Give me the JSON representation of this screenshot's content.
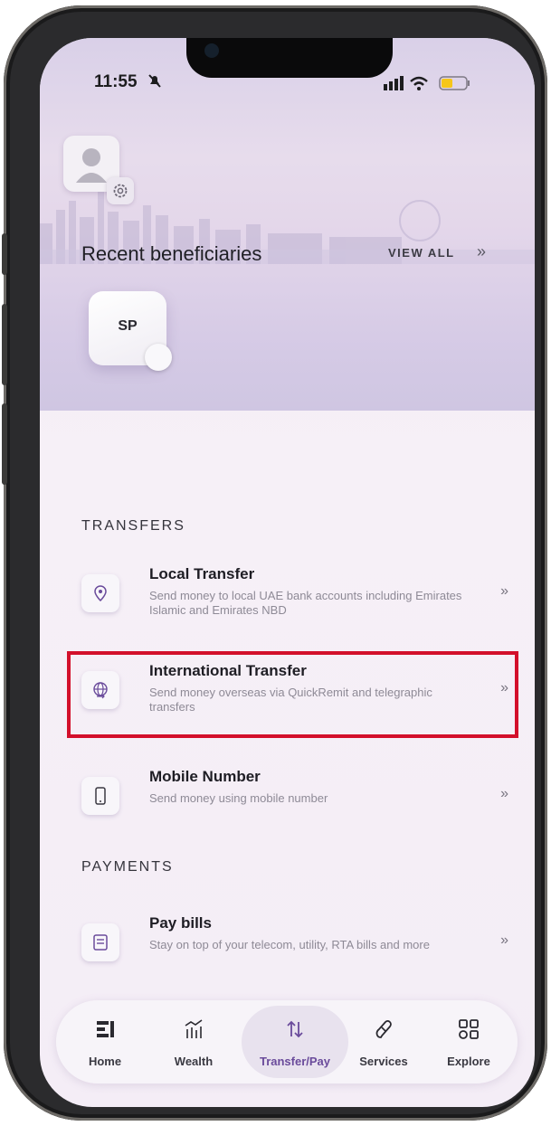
{
  "status_bar": {
    "time": "11:55"
  },
  "beneficiaries": {
    "title": "Recent beneficiaries",
    "view_all": "VIEW ALL",
    "items": [
      {
        "initials": "SP"
      }
    ]
  },
  "transfers": {
    "section_title": "TRANSFERS",
    "items": [
      {
        "title": "Local Transfer",
        "description": "Send money to local UAE bank accounts including Emirates Islamic and  Emirates NBD",
        "icon": "location-pin-icon"
      },
      {
        "title": "International Transfer",
        "description": "Send money overseas via QuickRemit and telegraphic transfers",
        "icon": "globe-transfer-icon"
      },
      {
        "title": "Mobile Number",
        "description": "Send money using mobile number",
        "icon": "mobile-phone-icon"
      }
    ]
  },
  "payments": {
    "section_title": "PAYMENTS",
    "items": [
      {
        "title": "Pay bills",
        "description": "Stay on top of your telecom, utility, RTA bills and more",
        "icon": "bill-icon"
      }
    ]
  },
  "nav": {
    "items": [
      {
        "label": "Home",
        "icon": "home-icon"
      },
      {
        "label": "Wealth",
        "icon": "wealth-icon"
      },
      {
        "label": "Transfer/Pay",
        "icon": "transfer-icon",
        "active": true
      },
      {
        "label": "Services",
        "icon": "services-icon"
      },
      {
        "label": "Explore",
        "icon": "explore-icon"
      }
    ]
  },
  "colors": {
    "accent": "#6a4b9b",
    "highlight": "#d3102b",
    "background": "#f4edf6"
  }
}
